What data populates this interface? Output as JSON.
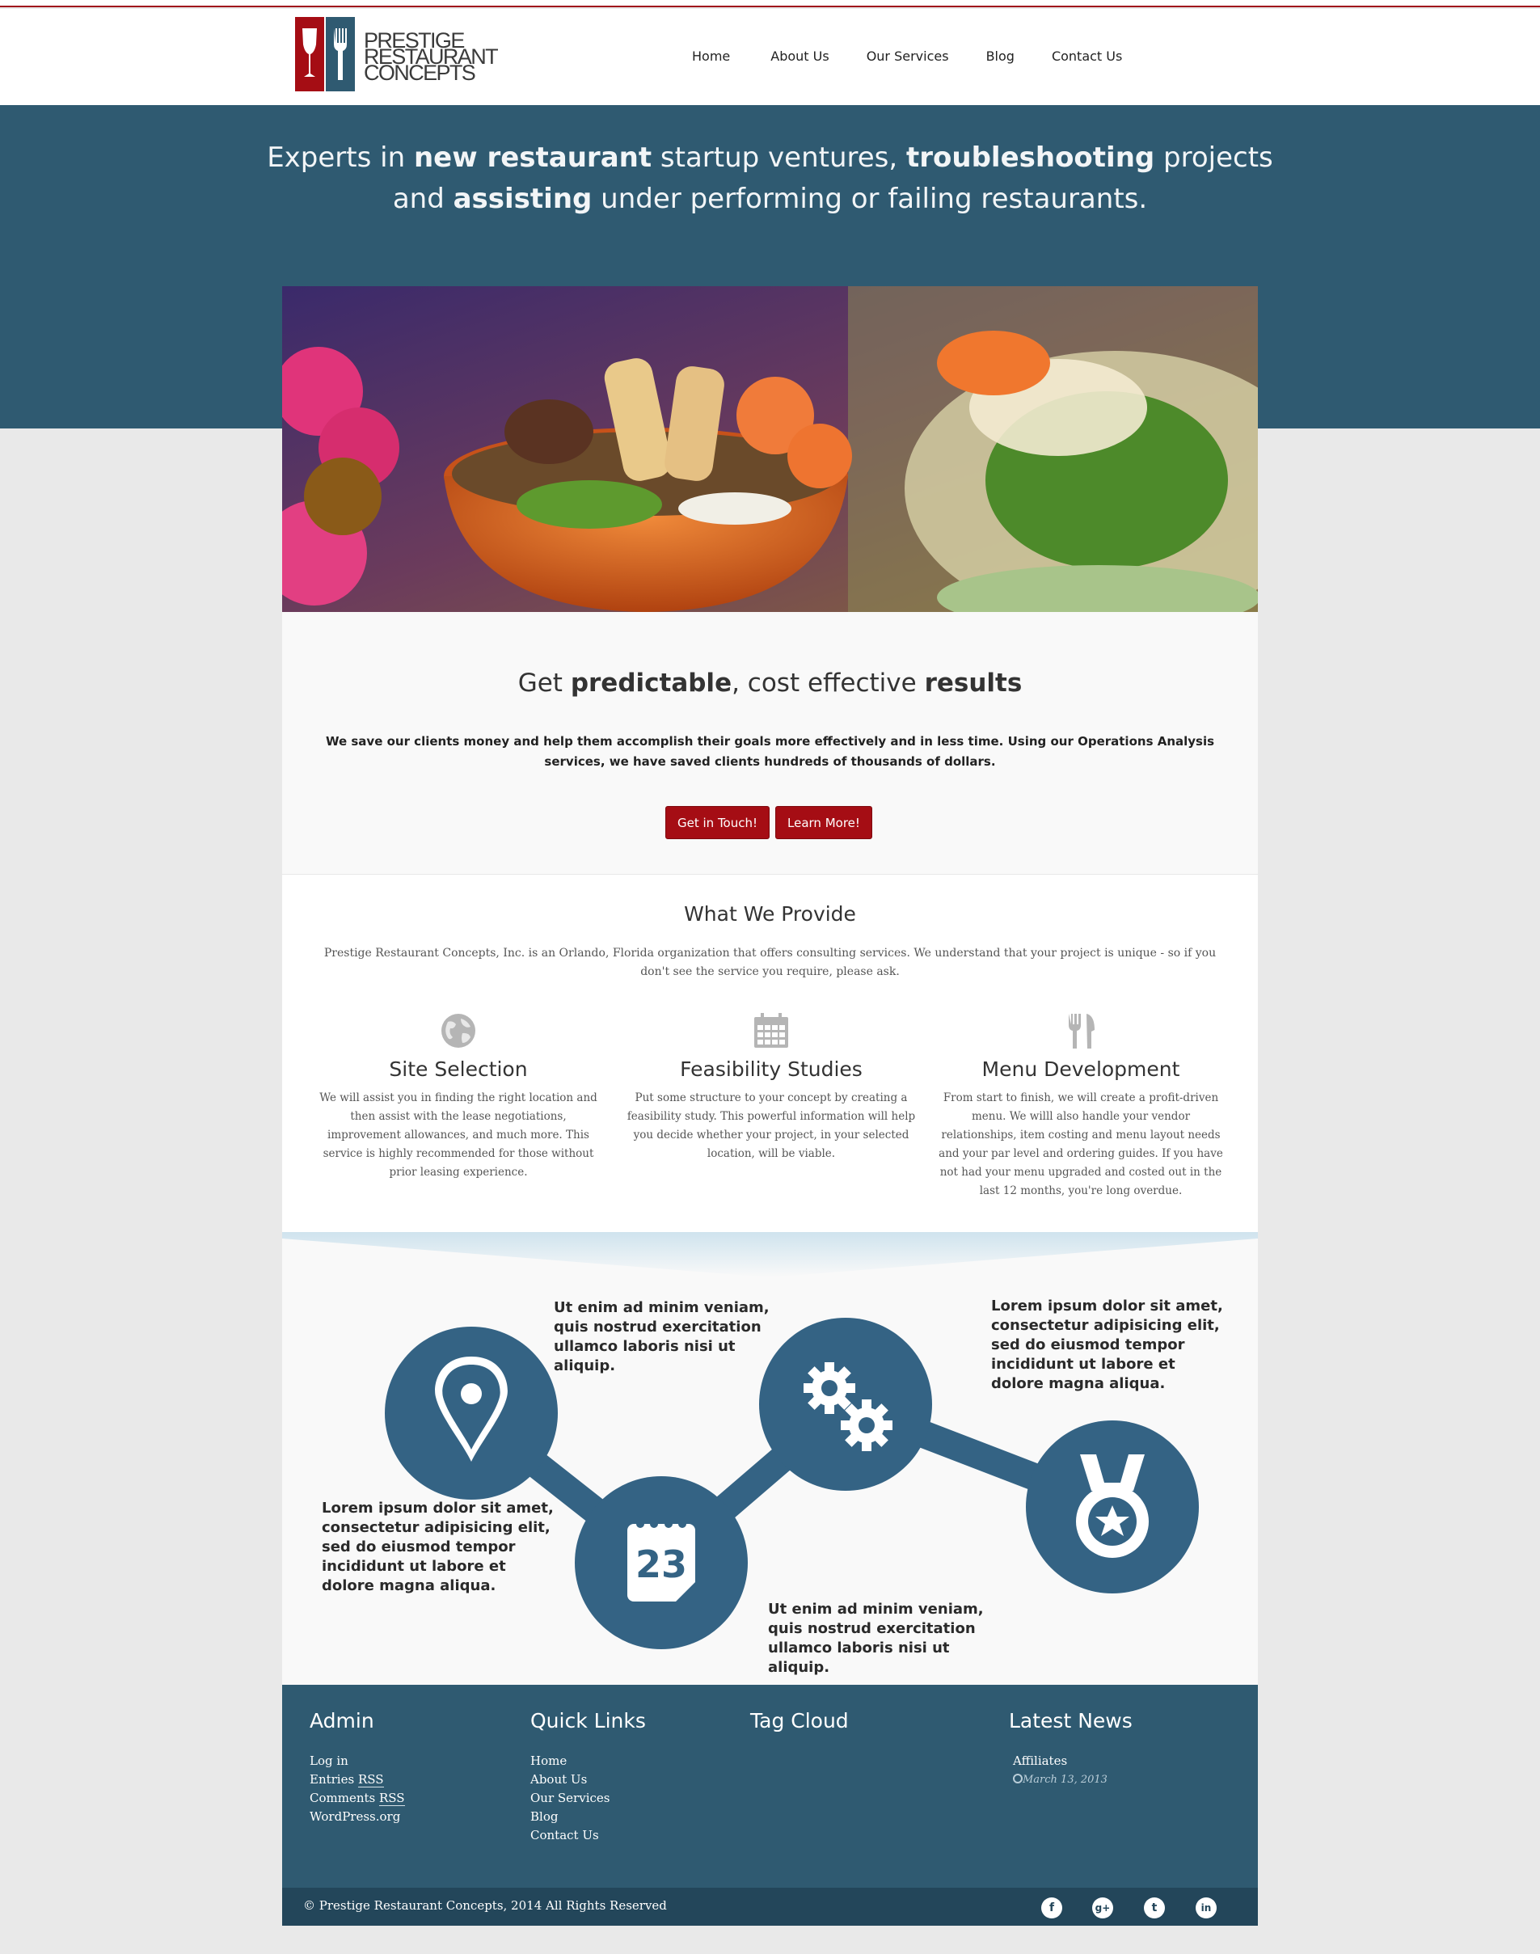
{
  "brand": {
    "name_lines": [
      "PRESTIGE",
      "RESTAURANT",
      "CONCEPTS"
    ]
  },
  "nav": {
    "items": [
      "Home",
      "About Us",
      "Our Services",
      "Blog",
      "Contact Us"
    ]
  },
  "hero": {
    "line1_a": "Experts in ",
    "line1_b": "new restaurant",
    "line1_c": " startup ventures, ",
    "line1_d": "troubleshooting",
    "line1_e": " projects",
    "line2_a": "and ",
    "line2_b": "assisting",
    "line2_c": " under performing or failing restaurants."
  },
  "intro": {
    "title_a": "Get ",
    "title_b": "predictable",
    "title_c": ", cost effective ",
    "title_d": "results",
    "body": "We save our clients money and help them accomplish their goals more effectively and in less time. Using our Operations Analysis services, we have saved clients hundreds of thousands of dollars.",
    "btn_touch": "Get in Touch!",
    "btn_learn": "Learn More!"
  },
  "provide": {
    "title": "What We Provide",
    "lead": "Prestige Restaurant Concepts, Inc. is an Orlando, Florida organization that offers consulting services. We understand that your project is unique - so if you don't see the service you require, please ask.",
    "services": [
      {
        "icon": "globe-icon",
        "title": "Site Selection",
        "text": "We will assist you in finding the right location and then assist with the lease negotiations, improvement allowances, and much more. This service is highly recommended for those without prior leasing experience."
      },
      {
        "icon": "calendar-icon",
        "title": "Feasibility Studies",
        "text": "Put some structure to your concept by creating a feasibility study. This powerful information will help you decide whether your project, in your selected location, will be viable."
      },
      {
        "icon": "fork-knife-icon",
        "title": "Menu Development",
        "text": "From start to finish, we will create a profit-driven menu. We willl also handle your vendor relationships, item costing and menu layout needs and your par level and ordering guides. If you have not had your menu upgraded and costed out in the last 12 months, you're long overdue."
      }
    ]
  },
  "process": {
    "calendar_day": "23",
    "notes": [
      "Ut enim ad minim veniam, quis nostrud exercitation ullamco laboris nisi ut aliquip.",
      "Lorem ipsum dolor sit amet, consectetur adipisicing elit, sed do eiusmod tempor incididunt ut labore et dolore magna aliqua.",
      "Lorem ipsum dolor sit amet, consectetur adipisicing elit, sed do eiusmod tempor incididunt ut labore et dolore magna aliqua.",
      "Ut enim ad minim veniam, quis nostrud exercitation ullamco laboris nisi ut aliquip."
    ]
  },
  "footer": {
    "admin": {
      "title": "Admin",
      "links": [
        "Log in",
        "Entries ",
        "Comments ",
        "WordPress.org"
      ],
      "rss": "RSS"
    },
    "quick": {
      "title": "Quick Links",
      "links": [
        "Home",
        "About Us",
        "Our Services",
        "Blog",
        "Contact Us"
      ]
    },
    "tags": {
      "title": "Tag Cloud"
    },
    "news": {
      "title": "Latest News",
      "item": "Affiliates",
      "date": "March 13, 2013"
    },
    "copyright": "© Prestige Restaurant Concepts, 2014 All Rights Reserved",
    "social": [
      "facebook-icon",
      "google-plus-icon",
      "twitter-icon",
      "linkedin-icon"
    ]
  },
  "colors": {
    "brand_blue": "#2f5a71",
    "brand_red": "#a50d14",
    "circle_blue": "#346384"
  }
}
